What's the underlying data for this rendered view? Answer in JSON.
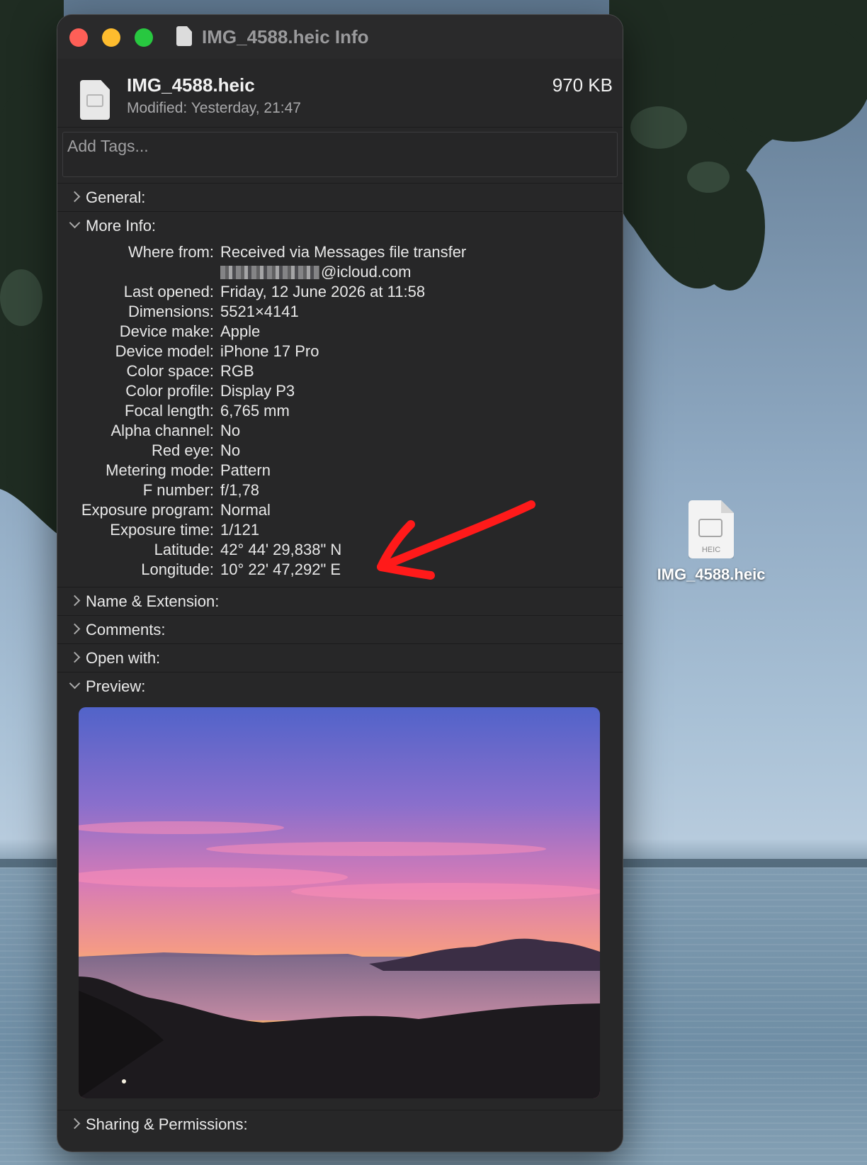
{
  "window": {
    "title": "IMG_4588.heic Info",
    "file_name": "IMG_4588.heic",
    "file_size": "970 KB",
    "modified_label": "Modified:",
    "modified_value": "Yesterday, 21:47",
    "tags_placeholder": "Add Tags..."
  },
  "sections": {
    "general": "General:",
    "more_info": "More Info:",
    "name_extension": "Name & Extension:",
    "comments": "Comments:",
    "open_with": "Open with:",
    "preview": "Preview:",
    "sharing": "Sharing & Permissions:"
  },
  "more_info": {
    "where_from_label": "Where from:",
    "where_from_value": "Received via Messages file transfer",
    "where_from_email_suffix": "@icloud.com",
    "rows": [
      {
        "label": "Last opened:",
        "value": "Friday, 12 June 2026 at 11:58"
      },
      {
        "label": "Dimensions:",
        "value": "5521×4141"
      },
      {
        "label": "Device make:",
        "value": "Apple"
      },
      {
        "label": "Device model:",
        "value": "iPhone 17 Pro"
      },
      {
        "label": "Color space:",
        "value": "RGB"
      },
      {
        "label": "Color profile:",
        "value": "Display P3"
      },
      {
        "label": "Focal length:",
        "value": "6,765 mm"
      },
      {
        "label": "Alpha channel:",
        "value": "No"
      },
      {
        "label": "Red eye:",
        "value": "No"
      },
      {
        "label": "Metering mode:",
        "value": "Pattern"
      },
      {
        "label": "F number:",
        "value": "f/1,78"
      },
      {
        "label": "Exposure program:",
        "value": "Normal"
      },
      {
        "label": "Exposure time:",
        "value": "1/121"
      },
      {
        "label": "Latitude:",
        "value": "42° 44' 29,838\" N"
      },
      {
        "label": "Longitude:",
        "value": "10° 22' 47,292\" E"
      }
    ]
  },
  "desktop": {
    "file_name": "IMG_4588.heic",
    "file_ext": "HEIC"
  },
  "colors": {
    "window_bg": "#272728",
    "close": "#fe5f57",
    "minimize": "#febc2e",
    "zoom": "#28c840",
    "annotation_arrow": "#ff1a1a"
  }
}
